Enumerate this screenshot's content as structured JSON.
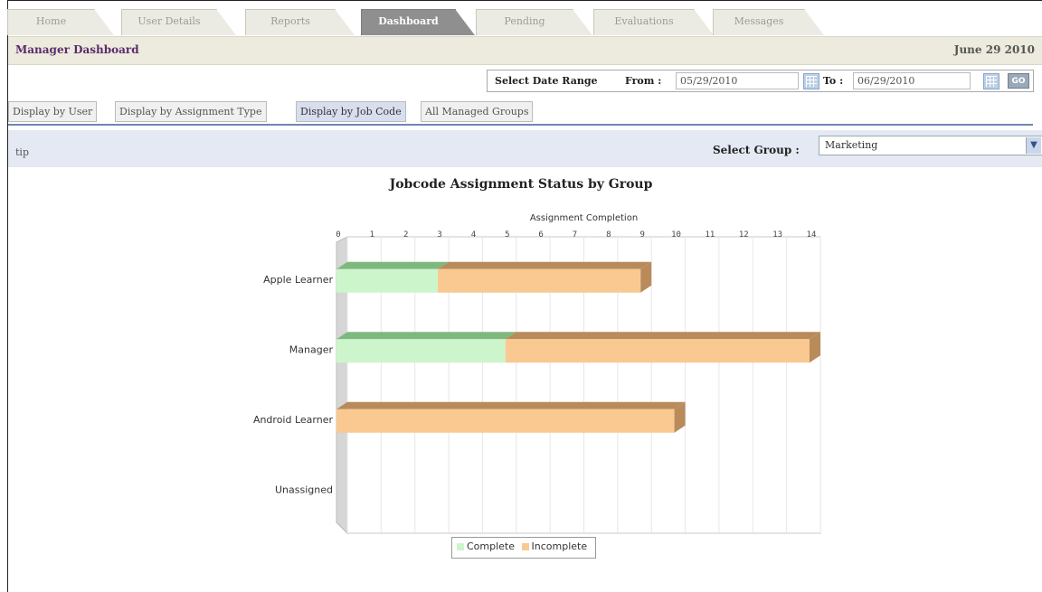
{
  "tabs": [
    {
      "label": "Home"
    },
    {
      "label": "User Details"
    },
    {
      "label": "Reports"
    },
    {
      "label": "Dashboard",
      "active": true
    },
    {
      "label": "Pending"
    },
    {
      "label": "Evaluations"
    },
    {
      "label": "Messages"
    }
  ],
  "header": {
    "title": "Manager Dashboard",
    "date": "June 29 2010"
  },
  "date_range": {
    "label": "Select Date Range",
    "from_label": "From :",
    "from_value": "05/29/2010",
    "to_label": "To :",
    "to_value": "06/29/2010",
    "go_label": "GO"
  },
  "subtabs": [
    {
      "label": "Display by User"
    },
    {
      "label": "Display by Assignment Type"
    },
    {
      "label": "Display by Job Code",
      "active": true
    },
    {
      "label": "All Managed Groups"
    }
  ],
  "tip": "tip",
  "group_select": {
    "label": "Select Group :",
    "value": "Marketing"
  },
  "chart_data": {
    "type": "bar",
    "orientation": "horizontal",
    "stacked": true,
    "title": "Jobcode Assignment Status by Group",
    "xlabel": "Assignment Completion",
    "xlim": [
      0,
      14
    ],
    "ticks": [
      0,
      1,
      2,
      3,
      4,
      5,
      6,
      7,
      8,
      9,
      10,
      11,
      12,
      13,
      14
    ],
    "categories": [
      "Apple Learner",
      "Manager",
      "Android Learner",
      "Unassigned"
    ],
    "series": [
      {
        "name": "Complete",
        "color": "#ccf5cc",
        "values": [
          3,
          5,
          0,
          0
        ]
      },
      {
        "name": "Incomplete",
        "color": "#f9c991",
        "values": [
          6,
          9,
          10,
          0
        ]
      }
    ],
    "legend_position": "bottom"
  }
}
